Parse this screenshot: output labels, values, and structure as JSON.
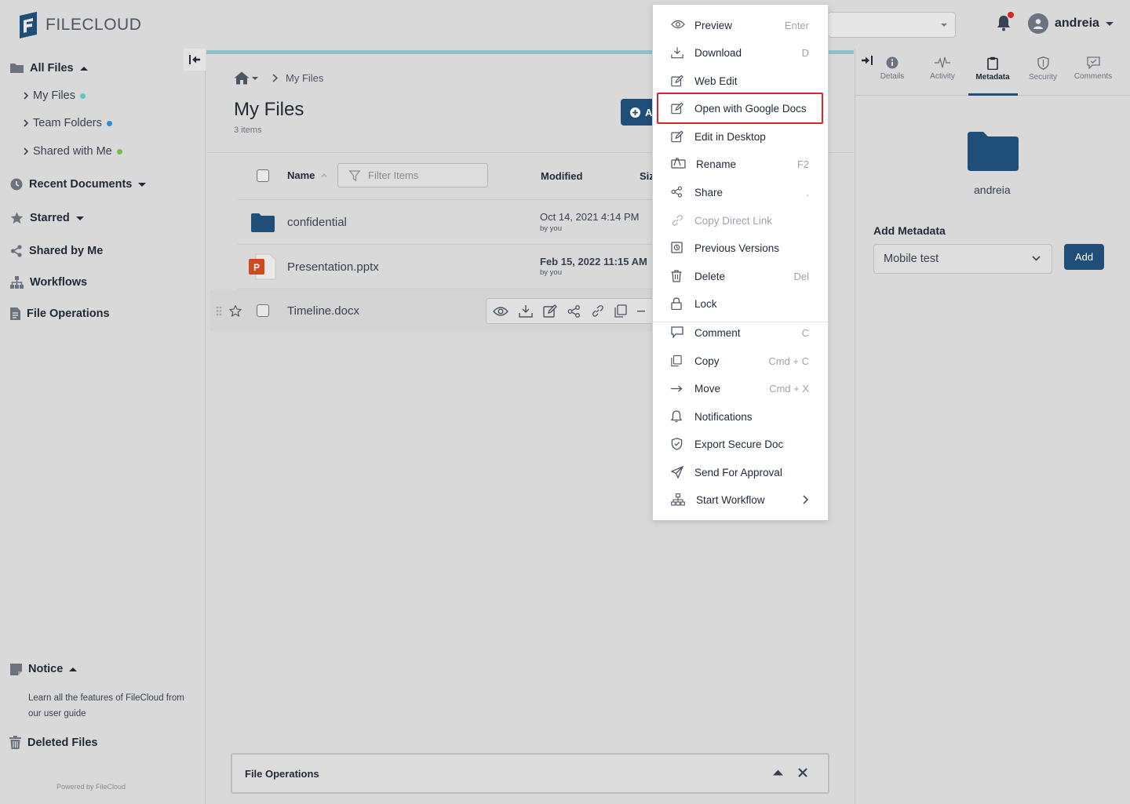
{
  "app": {
    "logo_text": "FILECLOUD",
    "user_name": "andreia"
  },
  "sidebar": {
    "all_files": "All Files",
    "my_files": "My Files",
    "team_folders": "Team Folders",
    "shared_with_me": "Shared with Me",
    "recent_documents": "Recent Documents",
    "starred": "Starred",
    "shared_by_me": "Shared by Me",
    "workflows": "Workflows",
    "file_operations": "File Operations",
    "notice": "Notice",
    "notice_text": "Learn all the features of FileCloud from our user guide",
    "deleted_files": "Deleted Files",
    "powered_by": "Powered by FileCloud",
    "dot_colors": {
      "my_files": "#5ec5c5",
      "team_folders": "#2b8fd6",
      "shared_with_me": "#6cc24a"
    }
  },
  "main": {
    "breadcrumb_current": "My Files",
    "title": "My Files",
    "items_count": "3 items",
    "add_label": "A",
    "columns": {
      "name": "Name",
      "modified": "Modified",
      "size": "Siz"
    },
    "filter_placeholder": "Filter Items",
    "rows": [
      {
        "name": "confidential",
        "modified": "Oct 14, 2021 4:14 PM",
        "by": "by you",
        "icon": "folder-icon"
      },
      {
        "name": "Presentation.pptx",
        "modified": "Feb 15, 2022 11:15 AM",
        "by": "by you",
        "icon": "pptx-icon"
      },
      {
        "name": "Timeline.docx",
        "modified": "",
        "by": "",
        "icon": "docx-icon"
      }
    ]
  },
  "context_menu": {
    "items": [
      {
        "label": "Preview",
        "shortcut": "Enter",
        "icon": "eye-icon"
      },
      {
        "label": "Download",
        "shortcut": "D",
        "icon": "download-icon"
      },
      {
        "label": "Web Edit",
        "shortcut": "",
        "icon": "edit-icon"
      },
      {
        "label": "Open with Google Docs",
        "shortcut": "",
        "icon": "edit-icon"
      },
      {
        "label": "Edit in Desktop",
        "shortcut": "",
        "icon": "edit-icon"
      },
      {
        "label": "Rename",
        "shortcut": "F2",
        "icon": "rename-icon"
      },
      {
        "label": "Share",
        "shortcut": ".",
        "icon": "share-icon"
      },
      {
        "label": "Copy Direct Link",
        "shortcut": "",
        "icon": "link-icon",
        "disabled": true
      },
      {
        "label": "Previous Versions",
        "shortcut": "",
        "icon": "versions-icon"
      },
      {
        "label": "Delete",
        "shortcut": "Del",
        "icon": "trash-icon"
      },
      {
        "label": "Lock",
        "shortcut": "",
        "icon": "lock-icon"
      },
      {
        "label": "Comment",
        "shortcut": "C",
        "icon": "comment-icon"
      },
      {
        "label": "Copy",
        "shortcut": "Cmd + C",
        "icon": "copy-icon"
      },
      {
        "label": "Move",
        "shortcut": "Cmd + X",
        "icon": "arrow-right-icon"
      },
      {
        "label": "Notifications",
        "shortcut": "",
        "icon": "bell-icon"
      },
      {
        "label": "Export Secure Doc",
        "shortcut": "",
        "icon": "shield-check-icon"
      },
      {
        "label": "Send For Approval",
        "shortcut": "",
        "icon": "send-icon"
      },
      {
        "label": "Start Workflow",
        "shortcut": "",
        "icon": "workflow-icon"
      }
    ]
  },
  "right_panel": {
    "tabs": [
      "Details",
      "Activity",
      "Metadata",
      "Security",
      "Comments"
    ],
    "active_tab": "Metadata",
    "folder_owner": "andreia",
    "add_metadata_title": "Add Metadata",
    "metadata_select_value": "Mobile test",
    "add_button": "Add"
  },
  "file_operations_panel": {
    "title": "File Operations"
  },
  "colors": {
    "brand": "#1f4e79",
    "highlight": "#dc2626",
    "background": "#d9d9d9"
  }
}
